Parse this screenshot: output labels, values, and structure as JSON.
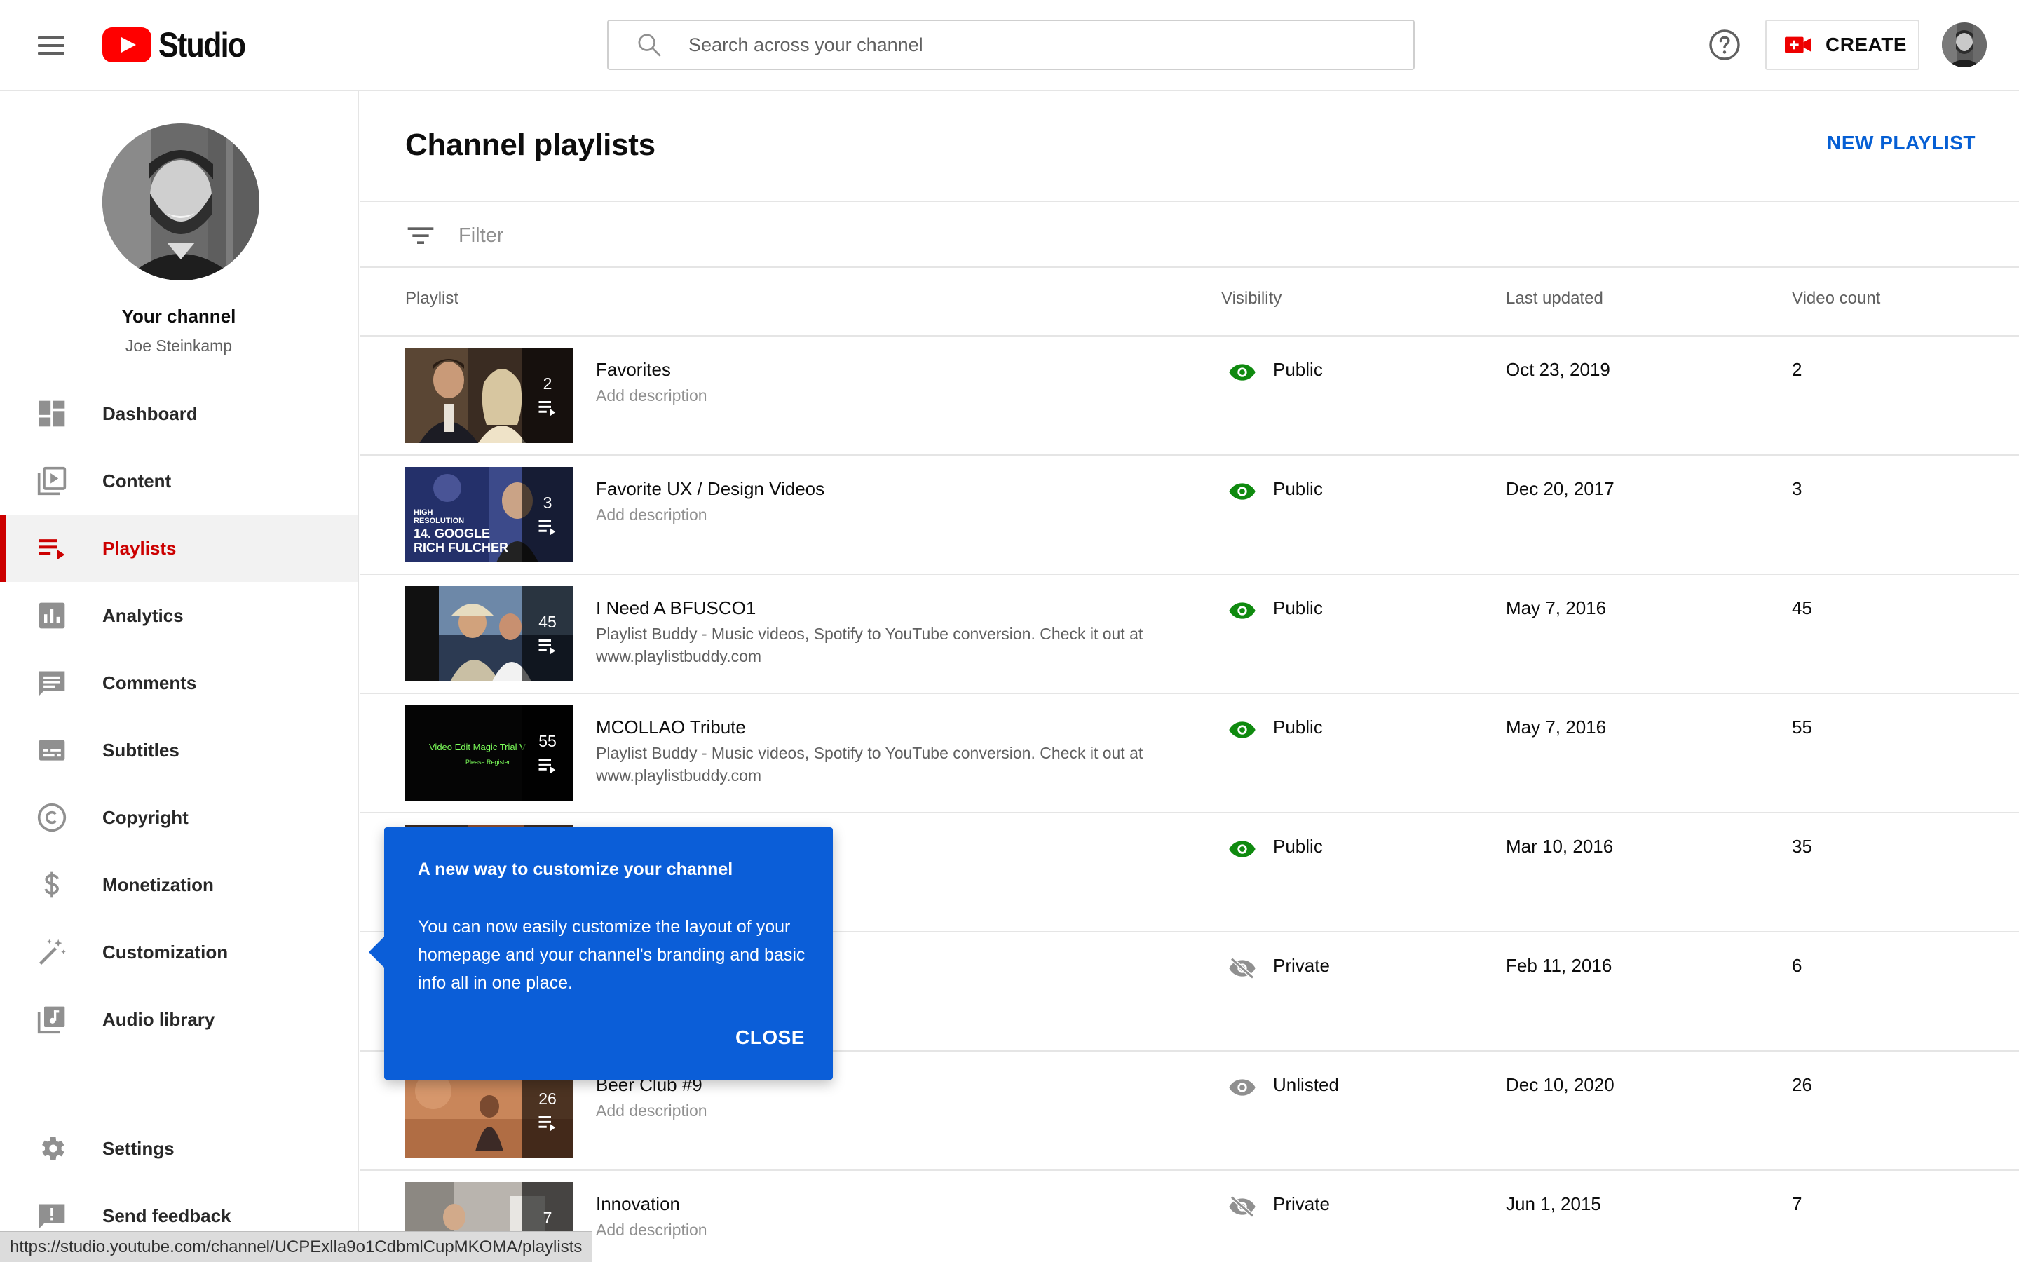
{
  "header": {
    "menu_icon": "hamburger-menu-icon",
    "logo_text": "Studio",
    "search_placeholder": "Search across your channel",
    "help_icon": "help-circle-icon",
    "create_label": "CREATE",
    "create_icon": "video-camera-plus-icon",
    "brand_red": "#ff0000"
  },
  "sidebar": {
    "channel_title": "Your channel",
    "channel_name": "Joe Steinkamp",
    "items": [
      {
        "label": "Dashboard",
        "icon": "dashboard-icon",
        "active": false
      },
      {
        "label": "Content",
        "icon": "content-icon",
        "active": false
      },
      {
        "label": "Playlists",
        "icon": "playlists-icon",
        "active": true
      },
      {
        "label": "Analytics",
        "icon": "analytics-icon",
        "active": false
      },
      {
        "label": "Comments",
        "icon": "comments-icon",
        "active": false
      },
      {
        "label": "Subtitles",
        "icon": "subtitles-icon",
        "active": false
      },
      {
        "label": "Copyright",
        "icon": "copyright-icon",
        "active": false
      },
      {
        "label": "Monetization",
        "icon": "dollar-icon",
        "active": false
      },
      {
        "label": "Customization",
        "icon": "magic-wand-icon",
        "active": false
      },
      {
        "label": "Audio library",
        "icon": "audio-library-icon",
        "active": false
      }
    ],
    "bottom_items": [
      {
        "label": "Settings",
        "icon": "gear-icon"
      },
      {
        "label": "Send feedback",
        "icon": "feedback-icon"
      }
    ],
    "active_color": "#cc0000"
  },
  "main": {
    "title": "Channel playlists",
    "new_playlist_label": "NEW PLAYLIST",
    "filter_placeholder": "Filter",
    "columns": [
      "Playlist",
      "Visibility",
      "Last updated",
      "Video count"
    ],
    "accent_color": "#065fd4",
    "rows": [
      {
        "title": "Favorites",
        "description": "Add description",
        "desc_placeholder": true,
        "visibility": "Public",
        "last_updated": "Oct 23, 2019",
        "video_count": "2",
        "thumb_count": "2"
      },
      {
        "title": "Favorite UX / Design Videos",
        "description": "Add description",
        "desc_placeholder": true,
        "visibility": "Public",
        "last_updated": "Dec 20, 2017",
        "video_count": "3",
        "thumb_count": "3",
        "thumb_text": [
          "HIGH",
          "RESOLUTION",
          "14. GOOGLE",
          "RICH FULCHER"
        ]
      },
      {
        "title": "I Need A BFUSCO1",
        "description": "Playlist Buddy - Music videos, Spotify to YouTube conversion. Check it out at www.playlistbuddy.com",
        "desc_placeholder": false,
        "visibility": "Public",
        "last_updated": "May 7, 2016",
        "video_count": "45",
        "thumb_count": "45"
      },
      {
        "title": "MCOLLAO Tribute",
        "description": "Playlist Buddy - Music videos, Spotify to YouTube conversion. Check it out at www.playlistbuddy.com",
        "desc_placeholder": false,
        "visibility": "Public",
        "last_updated": "May 7, 2016",
        "video_count": "55",
        "thumb_count": "55",
        "thumb_text": [
          "Video Edit Magic Trial V",
          "Please Register"
        ]
      },
      {
        "title": "",
        "description": "",
        "desc_placeholder": true,
        "visibility": "Public",
        "last_updated": "Mar 10, 2016",
        "video_count": "35",
        "thumb_count": ""
      },
      {
        "title": "",
        "description": "",
        "desc_placeholder": true,
        "visibility": "Private",
        "last_updated": "Feb 11, 2016",
        "video_count": "6",
        "thumb_count": ""
      },
      {
        "title": "Beer Club #9",
        "description": "Add description",
        "desc_placeholder": true,
        "visibility": "Unlisted",
        "last_updated": "Dec 10, 2020",
        "video_count": "26",
        "thumb_count": "26"
      },
      {
        "title": "Innovation",
        "description": "Add description",
        "desc_placeholder": true,
        "visibility": "Private",
        "last_updated": "Jun 1, 2015",
        "video_count": "7",
        "thumb_count": "7"
      }
    ],
    "visibility_colors": {
      "Public": "#0f8a0f",
      "Private": "#606060",
      "Unlisted": "#606060"
    }
  },
  "popup": {
    "title": "A new way to customize your channel",
    "body": "You can now easily customize the layout of your homepage and your channel's branding and basic info all in one place.",
    "close_label": "CLOSE",
    "bg_color": "#0b5ed8"
  },
  "status_bar": {
    "url": "https://studio.youtube.com/channel/UCPExlla9o1CdbmlCupMKOMA/playlists"
  }
}
